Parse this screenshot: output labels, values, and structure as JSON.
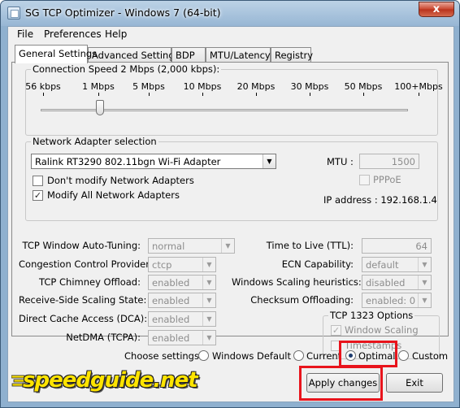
{
  "window": {
    "title": "SG TCP Optimizer - Windows 7 (64-bit)",
    "close_symbol": "x"
  },
  "menu": [
    "File",
    "Preferences",
    "Help"
  ],
  "tabs": [
    "General Settings",
    "Advanced Settings",
    "BDP",
    "MTU/Latency",
    "Registry"
  ],
  "connection_speed": {
    "label": "Connection Speed  2 Mbps (2,000 kbps):",
    "ticks": [
      "56 kbps",
      "1 Mbps",
      "5 Mbps",
      "10 Mbps",
      "20 Mbps",
      "30 Mbps",
      "50 Mbps",
      "100+Mbps"
    ],
    "slider_position": 0.18
  },
  "network_adapter": {
    "group_label": "Network Adapter selection",
    "selected_adapter": "Ralink RT3290 802.11bgn Wi-Fi Adapter",
    "dont_modify_label": "Don't modify Network Adapters",
    "modify_all_label": "Modify All Network Adapters",
    "mtu_label": "MTU :",
    "mtu_value": "1500",
    "pppoe_label": "PPPoE",
    "ip_address": "IP address : 192.168.1.4"
  },
  "settings_left": [
    {
      "label": "TCP Window Auto-Tuning:",
      "value": "normal"
    },
    {
      "label": "Congestion Control Provider:",
      "value": "ctcp"
    },
    {
      "label": "TCP Chimney Offload:",
      "value": "enabled"
    },
    {
      "label": "Receive-Side Scaling State:",
      "value": "enabled"
    },
    {
      "label": "Direct Cache Access (DCA):",
      "value": "enabled"
    },
    {
      "label": "NetDMA (TCPA):",
      "value": "enabled"
    }
  ],
  "settings_right": {
    "ttl_label": "Time to Live (TTL):",
    "ttl_value": "64",
    "ecn_label": "ECN Capability:",
    "ecn_value": "default",
    "wsh_label": "Windows Scaling heuristics:",
    "wsh_value": "disabled",
    "checksum_label": "Checksum Offloading:",
    "checksum_value": "enabled: 0"
  },
  "tcp1323": {
    "group_label": "TCP 1323 Options",
    "window_scaling_label": "Window Scaling",
    "timestamps_label": "Timestamps"
  },
  "choose": {
    "label": "Choose settings:",
    "options": [
      "Windows Default",
      "Current",
      "Optimal",
      "Custom"
    ],
    "selected": "Optimal"
  },
  "buttons": {
    "apply": "Apply changes",
    "exit": "Exit"
  },
  "logo": {
    "text": "speedguide.net"
  },
  "colors": {
    "highlight": "#e8141c",
    "logo_yellow": "#ffe400",
    "title_bar": "#97b6d4"
  }
}
